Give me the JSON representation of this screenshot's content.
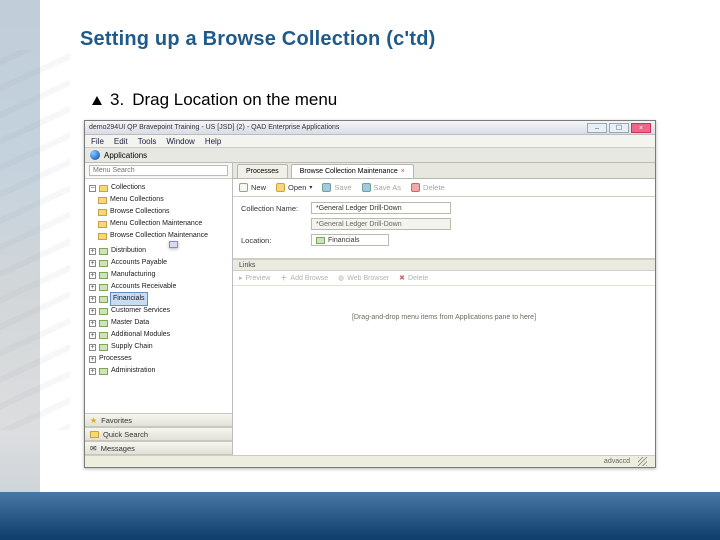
{
  "slide": {
    "title": "Setting up a Browse Collection (c'td)",
    "bullet_number": "3.",
    "bullet_text": "Drag Location on the menu"
  },
  "app": {
    "window_title": "demo294UI QP Bravepoint Training - US [JSD] (2) - QAD Enterprise Applications",
    "menubar": [
      "File",
      "Edit",
      "Tools",
      "Window",
      "Help"
    ],
    "app_label": "Applications",
    "search_placeholder": "Menu Search",
    "tree": {
      "root": "Collections",
      "root_children": [
        "Menu Collections",
        "Browse Collections",
        "Menu Collection Maintenance",
        "Browse Collection Maintenance"
      ],
      "modules": [
        "Distribution",
        "Accounts Payable",
        "Manufacturing",
        "Accounts Receivable",
        "Financials",
        "Customer Services",
        "Master Data",
        "Additional Modules",
        "Supply Chain",
        "Processes",
        "Administration"
      ],
      "highlighted": "Financials"
    },
    "sections": {
      "favorites": "Favorites",
      "quick_search": "Quick Search",
      "messages": "Messages"
    },
    "tabs": {
      "processes": "Processes",
      "active": "Browse Collection Maintenance"
    },
    "toolbar": {
      "new": "New",
      "open": "Open",
      "save": "Save",
      "save_as": "Save As",
      "delete": "Delete"
    },
    "form": {
      "collection_label": "Collection Name:",
      "collection_value": "*General Ledger Drill-Down",
      "collection_disabled_value": "*General Ledger Drill-Down",
      "location_label": "Location:",
      "location_value": "Financials"
    },
    "links": {
      "header": "Links",
      "preview": "Preview",
      "add_browse": "Add Browse",
      "web_browser": "Web Browser",
      "delete": "Delete",
      "drop_hint": "[Drag-and-drop menu items from Applications pane to here]"
    },
    "status_user": "advaccd"
  }
}
